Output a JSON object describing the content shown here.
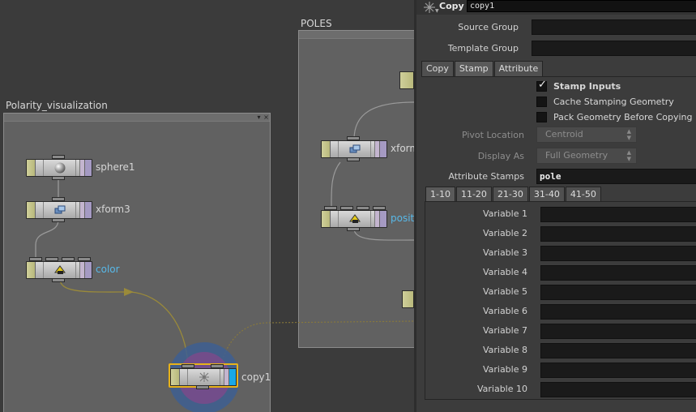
{
  "network": {
    "boxes": [
      {
        "id": "polarity",
        "title": "Polarity_visualization"
      },
      {
        "id": "poles",
        "title": "POLES"
      }
    ],
    "nodes": {
      "sphere1": "sphere1",
      "xform3": "xform3",
      "color": "color",
      "copy1": "copy1",
      "xform_poles": "xform",
      "posit": "posit"
    },
    "box_controls": {
      "pin": "▾",
      "close": "×"
    }
  },
  "params": {
    "op_type": "Copy",
    "node_name": "copy1",
    "source_group_label": "Source Group",
    "source_group_value": "",
    "template_group_label": "Template Group",
    "template_group_value": "",
    "tabs": [
      "Copy",
      "Stamp",
      "Attribute"
    ],
    "active_tab": "Stamp",
    "stamp_inputs_label": "Stamp Inputs",
    "stamp_inputs_checked": true,
    "cache_label": "Cache Stamping Geometry",
    "cache_checked": false,
    "pack_label": "Pack Geometry Before Copying",
    "pack_checked": false,
    "pivot_label": "Pivot Location",
    "pivot_value": "Centroid",
    "display_label": "Display As",
    "display_value": "Full Geometry",
    "attr_stamps_label": "Attribute Stamps",
    "attr_stamps_value": "pole",
    "var_tabs": [
      "1-10",
      "11-20",
      "21-30",
      "31-40",
      "41-50"
    ],
    "active_var_tab": "1-10",
    "variables": [
      "Variable 1",
      "Variable 2",
      "Variable 3",
      "Variable 4",
      "Variable 5",
      "Variable 6",
      "Variable 7",
      "Variable 8",
      "Variable 9",
      "Variable 10"
    ],
    "check_glyph": "✓",
    "menu_arrows": "▲\n▼"
  }
}
